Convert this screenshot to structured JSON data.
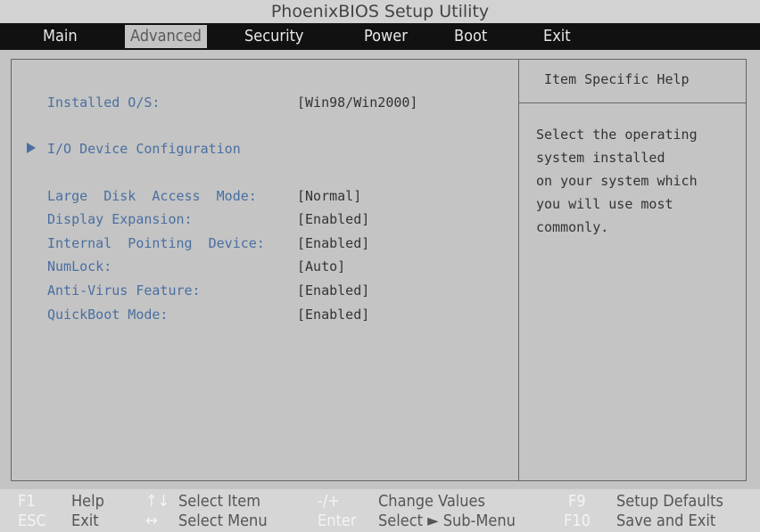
{
  "title": "PhoenixBIOS Setup Utility",
  "menu": [
    "Main",
    "Advanced",
    "Security",
    "Power",
    "Boot",
    "Exit"
  ],
  "active_menu": "Advanced",
  "settings": {
    "installed_os": {
      "label": "Installed O/S:",
      "value": "[Win98/Win2000]"
    },
    "io_device": {
      "label": "I/O Device Configuration"
    },
    "large_disk": {
      "label": "Large  Disk  Access  Mode:",
      "value": "[Normal]"
    },
    "display_exp": {
      "label": "Display Expansion:",
      "value": "[Enabled]"
    },
    "pointing": {
      "label": "Internal  Pointing  Device:",
      "value": "[Enabled]"
    },
    "numlock": {
      "label": "NumLock:",
      "value": "[Auto]"
    },
    "antivirus": {
      "label": "Anti-Virus Feature:",
      "value": "[Enabled]"
    },
    "quickboot": {
      "label": "QuickBoot Mode:",
      "value": "[Enabled]"
    }
  },
  "help": {
    "title": "Item Specific Help",
    "lines": [
      "Select the operating",
      "system installed",
      "on your system which",
      "you will use most",
      "commonly."
    ]
  },
  "footer": {
    "f1_key": "F1",
    "f1_text": "Help",
    "updown_key": "↑↓",
    "updown_text": "Select Item",
    "plusminus_key": "-/+",
    "plusminus_text": "Change Values",
    "f9_key": "F9",
    "f9_text": "Setup Defaults",
    "esc_key": "ESC",
    "esc_text": "Exit",
    "leftright_key": "↔",
    "leftright_text": "Select Menu",
    "enter_key": "Enter",
    "enter_text": "Select ► Sub-Menu",
    "f10_key": "F10",
    "f10_text": "Save and Exit"
  }
}
